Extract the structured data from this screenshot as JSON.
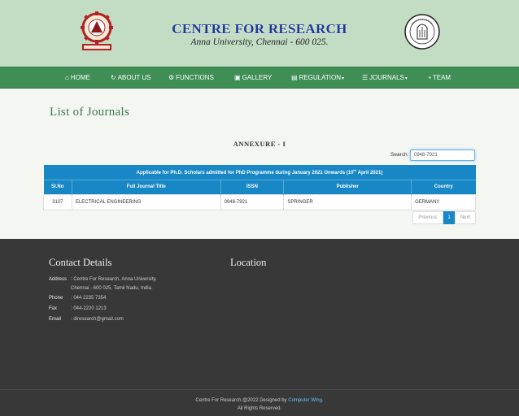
{
  "header": {
    "title": "CENTRE FOR RESEARCH",
    "subtitle": "Anna University, Chennai - 600 025."
  },
  "nav": [
    {
      "label": "HOME",
      "icon": "home-icon"
    },
    {
      "label": "ABOUT US",
      "icon": "refresh-icon"
    },
    {
      "label": "FUNCTIONS",
      "icon": "gears-icon"
    },
    {
      "label": "GALLERY",
      "icon": "image-icon"
    },
    {
      "label": "REGULATION",
      "icon": "book-icon",
      "dropdown": true
    },
    {
      "label": "JOURNALS",
      "icon": "list-icon",
      "dropdown": true
    },
    {
      "label": "TEAM",
      "icon": "id-badge-icon"
    }
  ],
  "main": {
    "page_title": "List of Journals",
    "annexure": "ANNEXURE - I",
    "search_label": "Search:",
    "search_value": "0948-7921",
    "table_caption_pre": "Applicable for Ph.D. Scholars admitted for PhD Programme during January 2021 Onwards (10",
    "table_caption_sup": "th",
    "table_caption_post": " April 2021)",
    "columns": [
      "Sl.No",
      "Full Journal Title",
      "ISSN",
      "Publisher",
      "Country"
    ],
    "rows": [
      [
        "3107",
        "ELECTRICAL ENGINEERING",
        "0948-7921",
        "SPRINGER",
        "GERMANY"
      ]
    ],
    "pagination": {
      "prev": "Previous",
      "current": "1",
      "next": "Next"
    }
  },
  "footer": {
    "contact_heading": "Contact Details",
    "location_heading": "Location",
    "address_label": "Address",
    "address_line1": ": Centre For Research, Anna University,",
    "address_line2": "Chennai - 600 025, Tamil Nadu, India.",
    "phone_label": "Phone",
    "phone_value": ": 044 2235 7354",
    "fax_label": "Fax",
    "fax_value": ": 044-2220 1213",
    "email_label": "Email",
    "email_value": ": diresearch@gmail.com",
    "copyright_pre": "Centre For Research @2022 Designed by ",
    "copyright_link": "Computer Wing.",
    "rights": "All Rights Reserved."
  },
  "colors": {
    "header_bg": "#c3ddc5",
    "nav_bg": "#3f8e56",
    "table_blue": "#1787c6",
    "footer_bg": "#383838",
    "title_blue": "#1f3a93"
  }
}
